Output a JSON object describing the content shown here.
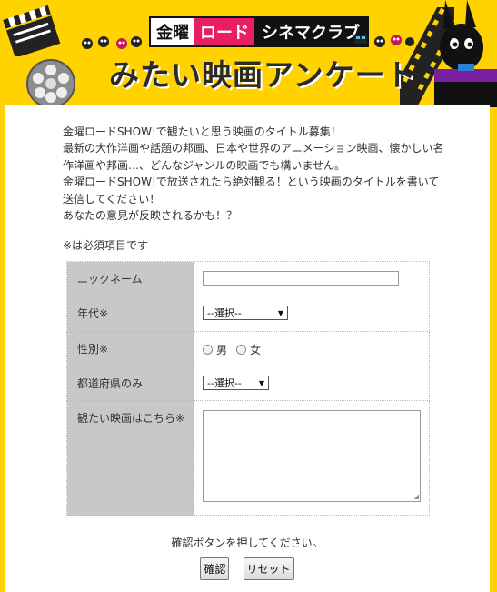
{
  "banner": {
    "brand_part1": "金曜",
    "brand_part2": "ロード",
    "brand_part3": "シネマクラブ",
    "title": "みたい映画アンケート"
  },
  "intro": {
    "lines": [
      "金曜ロードSHOW!で観たいと思う映画のタイトル募集！",
      "最新の大作洋画や話題の邦画、日本や世界のアニメーション映画、懐かしい名作洋画や邦画…、どんなジャンルの映画でも構いません。",
      "金曜ロードSHOW!で放送されたら絶対観る！という映画のタイトルを書いて送信してください！",
      "あなたの意見が反映されるかも！？"
    ]
  },
  "required_note": "※は必須項目です",
  "form": {
    "nickname_label": "ニックネーム",
    "nickname_value": "",
    "age_label": "年代※",
    "age_selected": "--選択--",
    "gender_label": "性別※",
    "gender_options": [
      "男",
      "女"
    ],
    "prefecture_label": "都道府県のみ",
    "prefecture_selected": "--選択--",
    "movie_label": "観たい映画はこちら※",
    "movie_value": ""
  },
  "confirm_note": "確認ボタンを押してください。",
  "buttons": {
    "confirm": "確認",
    "reset": "リセット"
  },
  "colors": {
    "banner_bg": "#ffd200",
    "label_cell_bg": "#c8c8c8"
  }
}
